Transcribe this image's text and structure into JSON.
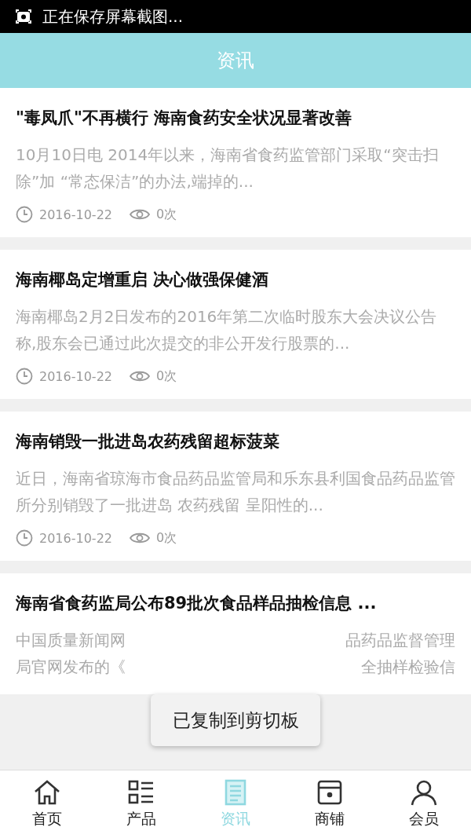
{
  "status_bar": {
    "text": "正在保存屏幕截图..."
  },
  "header": {
    "title": "资讯"
  },
  "articles": [
    {
      "title": "\"毒凤爪\"不再横行 海南食药安全状况显著改善",
      "summary": "10月10日电 2014年以来，海南省食药监管部门采取“突击扫除”加 “常态保洁”的办法,端掉的...",
      "date": "2016-10-22",
      "views": "0次"
    },
    {
      "title": "海南椰岛定增重启 决心做强保健酒",
      "summary": "海南椰岛2月2日发布的2016年第二次临时股东大会决议公告称,股东会已通过此次提交的非公开发行股票的...",
      "date": "2016-10-22",
      "views": "0次"
    },
    {
      "title": "海南销毁一批进岛农药残留超标菠菜",
      "summary": "近日，海南省琼海市食品药品监管局和乐东县利国食品药品监管所分别销毁了一批进岛 农药残留 呈阳性的...",
      "date": "2016-10-22",
      "views": "0次"
    },
    {
      "title": "海南省食药监局公布89批次食品样品抽检信息 ...",
      "summary_fragments": [
        {
          "left": "中国质量新闻网",
          "right": "品药品监督管理"
        },
        {
          "left": "局官网发布的《",
          "right": "全抽样检验信"
        }
      ]
    }
  ],
  "toast": {
    "text": "已复制到剪切板"
  },
  "tab_bar": [
    {
      "label": "首页",
      "kind": "home",
      "selected": false
    },
    {
      "label": "产品",
      "kind": "list",
      "selected": false
    },
    {
      "label": "资讯",
      "kind": "news",
      "selected": true
    },
    {
      "label": "商铺",
      "kind": "shop",
      "selected": false
    },
    {
      "label": "会员",
      "kind": "user",
      "selected": false
    }
  ]
}
